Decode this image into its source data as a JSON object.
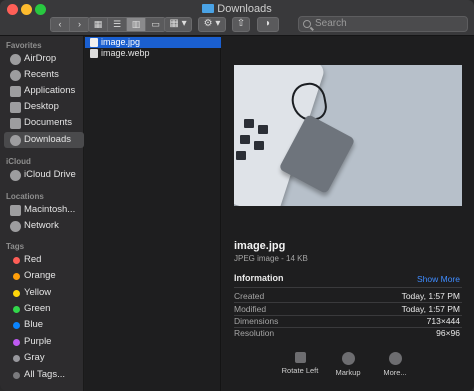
{
  "window": {
    "title": "Downloads"
  },
  "toolbar": {
    "back_label": "‹",
    "forward_label": "›",
    "search_placeholder": "Search"
  },
  "sidebar": {
    "favorites_header": "Favorites",
    "favorites": [
      {
        "label": "AirDrop",
        "icon": "airdrop-icon"
      },
      {
        "label": "Recents",
        "icon": "clock-icon"
      },
      {
        "label": "Applications",
        "icon": "applications-icon"
      },
      {
        "label": "Desktop",
        "icon": "desktop-icon"
      },
      {
        "label": "Documents",
        "icon": "document-icon"
      },
      {
        "label": "Downloads",
        "icon": "download-icon",
        "selected": true
      }
    ],
    "icloud_header": "iCloud",
    "icloud": [
      {
        "label": "iCloud Drive",
        "icon": "cloud-icon"
      }
    ],
    "locations_header": "Locations",
    "locations": [
      {
        "label": "Macintosh...",
        "icon": "disk-icon"
      },
      {
        "label": "Network",
        "icon": "globe-icon"
      }
    ],
    "tags_header": "Tags",
    "tags": [
      {
        "label": "Red",
        "color": "#ff5e57"
      },
      {
        "label": "Orange",
        "color": "#ff9f0a"
      },
      {
        "label": "Yellow",
        "color": "#ffd60a"
      },
      {
        "label": "Green",
        "color": "#32d74b"
      },
      {
        "label": "Blue",
        "color": "#0a84ff"
      },
      {
        "label": "Purple",
        "color": "#bf5af2"
      },
      {
        "label": "Gray",
        "color": "#98989d"
      },
      {
        "label": "All Tags...",
        "color": "#7a7a7d"
      }
    ]
  },
  "files": [
    {
      "name": "image.jpg",
      "selected": true
    },
    {
      "name": "image.webp",
      "selected": false
    }
  ],
  "preview": {
    "filename": "image.jpg",
    "kind": "JPEG image - 14 KB",
    "info_header": "Information",
    "show_more": "Show More",
    "rows": [
      {
        "key": "Created",
        "value": "Today, 1:57 PM"
      },
      {
        "key": "Modified",
        "value": "Today, 1:57 PM"
      },
      {
        "key": "Dimensions",
        "value": "713×444"
      },
      {
        "key": "Resolution",
        "value": "96×96"
      }
    ],
    "actions": [
      {
        "label": "Rotate Left",
        "icon": "rotate-left-icon"
      },
      {
        "label": "Markup",
        "icon": "markup-icon"
      },
      {
        "label": "More...",
        "icon": "more-icon"
      }
    ]
  },
  "colors": {
    "accent": "#1a5fd0",
    "link": "#3f8cff"
  }
}
